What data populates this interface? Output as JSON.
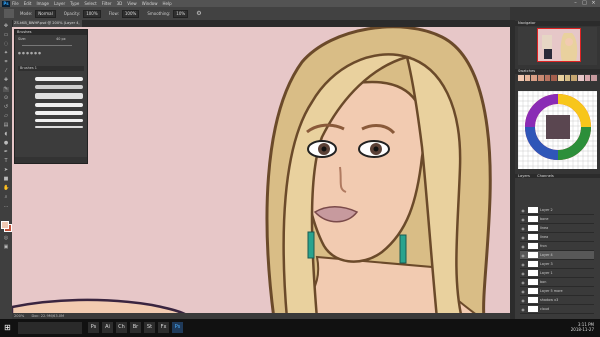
{
  "menubar": {
    "logo": "Ps",
    "items": [
      "File",
      "Edit",
      "Image",
      "Layer",
      "Type",
      "Select",
      "Filter",
      "3D",
      "View",
      "Window",
      "Help"
    ],
    "window_controls": [
      "–",
      "□",
      "×"
    ]
  },
  "options": {
    "mode_label": "Mode:",
    "mode_value": "Normal",
    "opacity_label": "Opacity:",
    "opacity_value": "100%",
    "flow_label": "Flow:",
    "flow_value": "100%",
    "smoothing_label": "Smoothing:",
    "smoothing_value": "10%"
  },
  "document": {
    "tab_label": "ZS.kKB_BWHP.psd @ 200% (Layer 4, RGB/8)"
  },
  "brushes_panel": {
    "title": "Brushes",
    "size_label": "Size:",
    "size_value": "40 px",
    "group_label": "Brushes 1"
  },
  "right_panels": {
    "navigator_title": "Navigator",
    "swatches_title": "Swatches",
    "layers_tabs": [
      "Layers",
      "Channels"
    ],
    "layers": [
      {
        "name": "Layer 2",
        "selected": false
      },
      {
        "name": "bone",
        "selected": false
      },
      {
        "name": "linea",
        "selected": false
      },
      {
        "name": "linea",
        "selected": false
      },
      {
        "name": "fron",
        "selected": false
      },
      {
        "name": "Layer 4",
        "selected": true
      },
      {
        "name": "Layer 3",
        "selected": false
      },
      {
        "name": "Layer 1",
        "selected": false
      },
      {
        "name": "bon",
        "selected": false
      },
      {
        "name": "Layer 5 more",
        "selected": false
      },
      {
        "name": "shadow x3",
        "selected": false
      },
      {
        "name": "cloud",
        "selected": false
      }
    ]
  },
  "status": {
    "zoom": "200%",
    "doc_size": "Doc: 22.9M/63.0M"
  },
  "taskbar": {
    "search_placeholder": "",
    "apps": [
      "Ps",
      "Ai",
      "Ch",
      "Br",
      "St",
      "Fx",
      "Ps"
    ],
    "time": "3:11 PM",
    "date": "2018-11-27"
  },
  "colors": {
    "canvas_bg": "#e7c7c8",
    "hair": "#e9d19e",
    "skin": "#f2cbb1",
    "earring": "#29a38e",
    "foreground": "#f1c9b3",
    "background": "#c0533b"
  }
}
